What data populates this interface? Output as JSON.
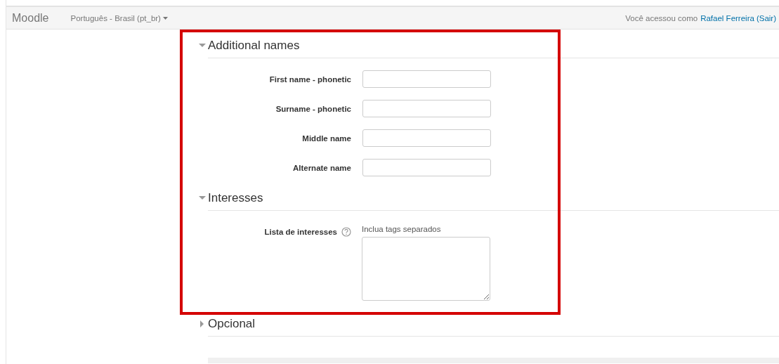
{
  "navbar": {
    "brand": "Moodle",
    "language": "Português - Brasil (pt_br)",
    "login_prefix": "Você acessou como",
    "user": "Rafael Ferreira",
    "logout": "(Sair)"
  },
  "sections": [
    {
      "title": "Additional names",
      "expanded": true,
      "fields": [
        {
          "kind": "text",
          "label": "First name - phonetic"
        },
        {
          "kind": "text",
          "label": "Surname - phonetic"
        },
        {
          "kind": "text",
          "label": "Middle name"
        },
        {
          "kind": "text",
          "label": "Alternate name"
        }
      ]
    },
    {
      "title": "Interesses",
      "expanded": true,
      "fields": [
        {
          "kind": "tags",
          "label": "Lista de interesses",
          "help": true,
          "hint": "Inclua tags separados"
        }
      ]
    },
    {
      "title": "Opcional",
      "expanded": false
    }
  ]
}
